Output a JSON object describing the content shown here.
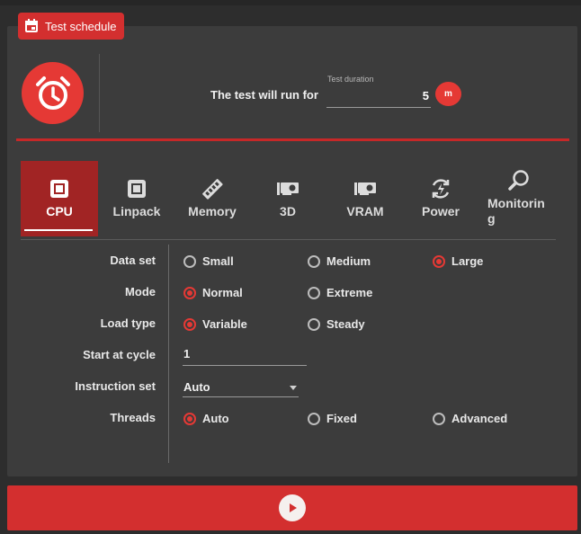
{
  "header": {
    "tag_label": "Test schedule",
    "run_text": "The test will run for",
    "duration_label": "Test duration",
    "duration_value": "5",
    "duration_unit": "m"
  },
  "tabs": [
    {
      "label": "CPU",
      "icon": "cpu-icon",
      "active": true
    },
    {
      "label": "Linpack",
      "icon": "linpack-icon",
      "active": false
    },
    {
      "label": "Memory",
      "icon": "memory-icon",
      "active": false
    },
    {
      "label": "3D",
      "icon": "gpu-icon",
      "active": false
    },
    {
      "label": "VRAM",
      "icon": "vram-icon",
      "active": false
    },
    {
      "label": "Power",
      "icon": "power-icon",
      "active": false
    },
    {
      "label": "Monitoring",
      "icon": "monitoring-icon",
      "active": false
    }
  ],
  "settings": {
    "data_set": {
      "label": "Data set",
      "options": [
        "Small",
        "Medium",
        "Large"
      ],
      "selected": "Large"
    },
    "mode": {
      "label": "Mode",
      "options": [
        "Normal",
        "Extreme"
      ],
      "selected": "Normal"
    },
    "load_type": {
      "label": "Load type",
      "options": [
        "Variable",
        "Steady"
      ],
      "selected": "Variable"
    },
    "start_at_cycle": {
      "label": "Start at cycle",
      "value": "1"
    },
    "instruction_set": {
      "label": "Instruction set",
      "value": "Auto"
    },
    "threads": {
      "label": "Threads",
      "options": [
        "Auto",
        "Fixed",
        "Advanced"
      ],
      "selected": "Auto"
    }
  },
  "colors": {
    "accent": "#d32f2f",
    "panel": "#3c3c3c",
    "background": "#2d2d2d"
  },
  "actions": {
    "start_icon": "play-icon"
  }
}
